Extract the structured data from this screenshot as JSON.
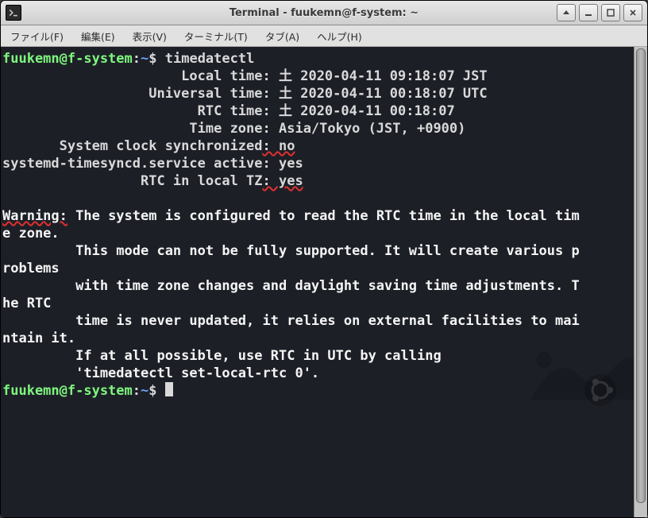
{
  "titlebar": {
    "title": "Terminal - fuukemn@f-system: ~"
  },
  "menubar": {
    "file": "ファイル(F)",
    "edit": "編集(E)",
    "view": "表示(V)",
    "terminal": "ターミナル(T)",
    "tab": "タブ(A)",
    "help": "ヘルプ(H)"
  },
  "prompt": {
    "user": "fuukemn@f-system",
    "path": "~",
    "symbol": "$"
  },
  "cmd1": "timedatectl",
  "out": {
    "l1": "                      Local time: 土 2020-04-11 09:18:07 JST",
    "l2": "                  Universal time: 土 2020-04-11 00:18:07 UTC",
    "l3": "                        RTC time: 土 2020-04-11 00:18:07",
    "l4": "                       Time zone: Asia/Tokyo (JST, +0900)",
    "l5a": "       System clock synchronized",
    "l5b": ": no",
    "l6": "systemd-timesyncd.service active: yes",
    "l7a": "                 RTC in local TZ",
    "l7b": ": yes"
  },
  "warn": {
    "label": "Warning:",
    "l1": " The system is configured to read the RTC time in the local tim",
    "l2": "e zone.",
    "l3": "         This mode can not be fully supported. It will create various p",
    "l4": "roblems",
    "l5": "         with time zone changes and daylight saving time adjustments. T",
    "l6": "he RTC",
    "l7": "         time is never updated, it relies on external facilities to mai",
    "l8": "ntain it.",
    "l9": "         If at all possible, use RTC in UTC by calling",
    "l10": "         'timedatectl set-local-rtc 0'."
  }
}
